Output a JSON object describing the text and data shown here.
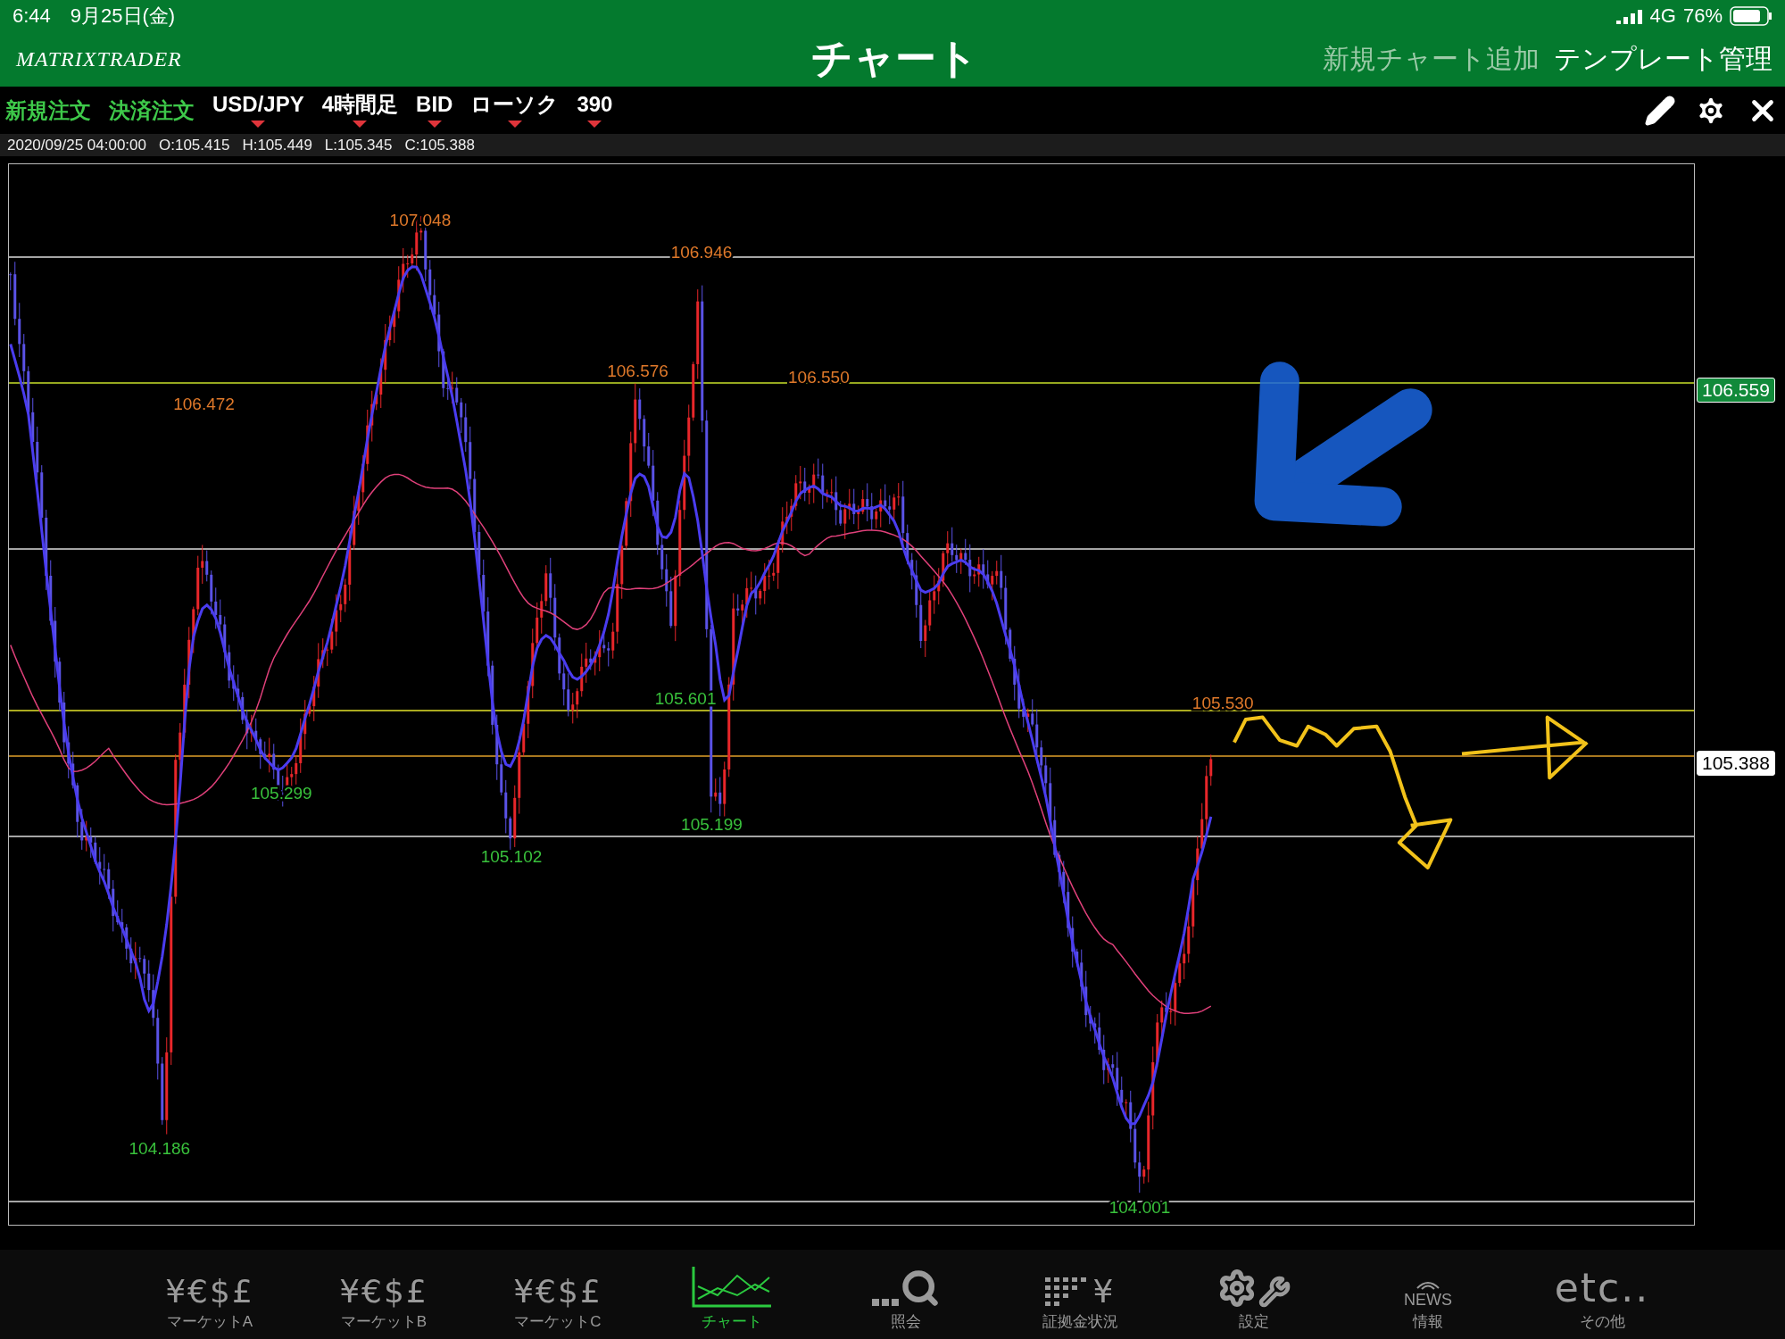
{
  "status_bar": {
    "time": "6:44",
    "date": "9月25日(金)",
    "network": "4G",
    "battery": "76%"
  },
  "header": {
    "logo": "MATRIXTRADER",
    "title": "チャート",
    "actions": [
      {
        "label": "新規チャート追加",
        "disabled": true
      },
      {
        "label": "テンプレート管理",
        "disabled": false
      }
    ]
  },
  "toolbar": {
    "orders": [
      "新規注文",
      "決済注文"
    ],
    "selectors": [
      "USD/JPY",
      "4時間足",
      "BID",
      "ローソク",
      "390"
    ]
  },
  "info": {
    "datetime": "2020/09/25 04:00:00",
    "values": [
      "O:105.415",
      "H:105.449",
      "L:105.345",
      "C:105.388"
    ]
  },
  "chart": {
    "annotations": [
      {
        "text": "107.048",
        "kind": "high"
      },
      {
        "text": "106.946",
        "kind": "high"
      },
      {
        "text": "106.576",
        "kind": "high"
      },
      {
        "text": "106.550",
        "kind": "high"
      },
      {
        "text": "106.472",
        "kind": "high"
      },
      {
        "text": "105.601",
        "kind": "low"
      },
      {
        "text": "105.530",
        "kind": "high"
      },
      {
        "text": "105.299",
        "kind": "low"
      },
      {
        "text": "105.199",
        "kind": "low"
      },
      {
        "text": "105.102",
        "kind": "low"
      },
      {
        "text": "104.186",
        "kind": "low"
      },
      {
        "text": "104.001",
        "kind": "low"
      }
    ],
    "price_tags": [
      {
        "text": "106.559",
        "kind": "line"
      },
      {
        "text": "105.388",
        "kind": "current"
      }
    ]
  },
  "tabs": [
    {
      "label": "マーケットA",
      "glyph": "¥€$£",
      "kind": "currency",
      "selected": false
    },
    {
      "label": "マーケットB",
      "glyph": "¥€$£",
      "kind": "currency",
      "selected": false
    },
    {
      "label": "マーケットC",
      "glyph": "¥€$£",
      "kind": "currency",
      "selected": false
    },
    {
      "label": "チャート",
      "kind": "chart",
      "selected": true
    },
    {
      "label": "照会",
      "kind": "search",
      "selected": false
    },
    {
      "label": "証拠金状況",
      "glyph": "¥",
      "kind": "margin",
      "selected": false
    },
    {
      "label": "設定",
      "kind": "settings",
      "selected": false
    },
    {
      "label": "情報",
      "glyph": "NEWS",
      "kind": "news",
      "selected": false
    },
    {
      "label": "その他",
      "glyph": "etc..",
      "kind": "text",
      "selected": false
    }
  ]
}
